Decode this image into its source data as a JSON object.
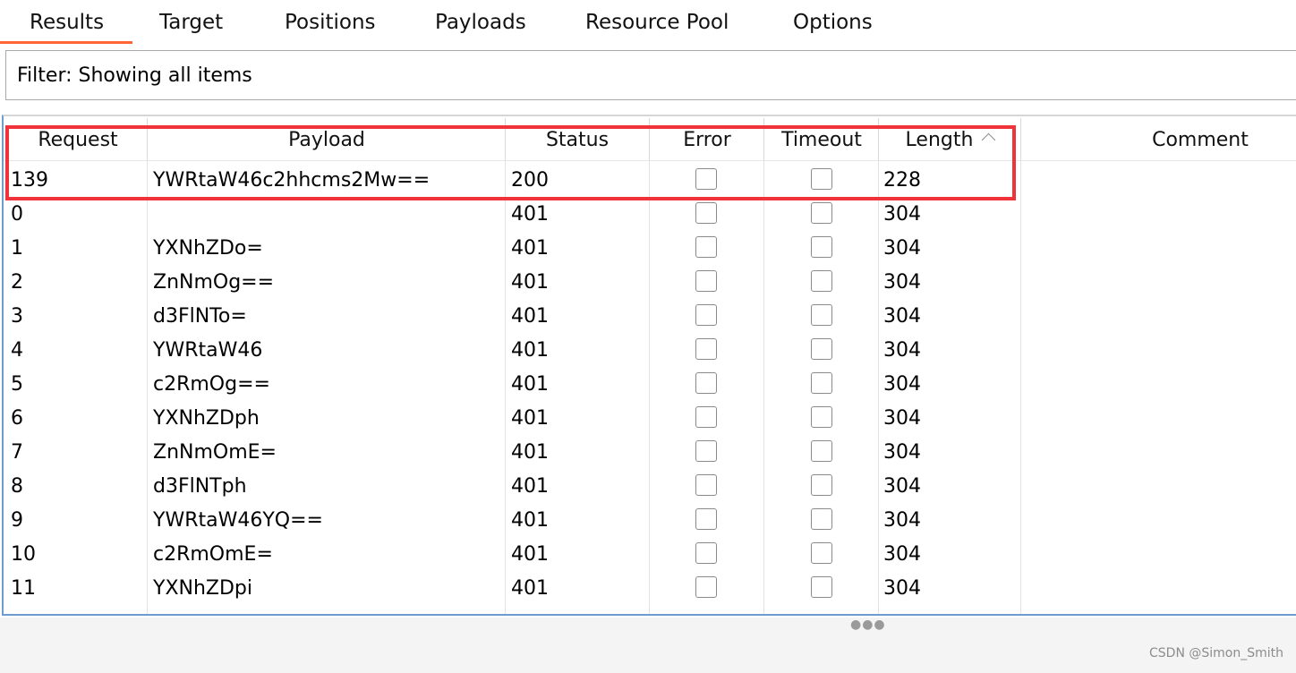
{
  "tabs": [
    {
      "label": "Results",
      "active": true
    },
    {
      "label": "Target",
      "active": false
    },
    {
      "label": "Positions",
      "active": false
    },
    {
      "label": "Payloads",
      "active": false
    },
    {
      "label": "Resource Pool",
      "active": false
    },
    {
      "label": "Options",
      "active": false
    }
  ],
  "accent_color": "#ff6633",
  "highlight_color": "#f0323a",
  "filter": {
    "text": "Filter: Showing all items"
  },
  "table": {
    "columns": {
      "request": "Request",
      "payload": "Payload",
      "status": "Status",
      "error": "Error",
      "timeout": "Timeout",
      "length": "Length",
      "comment": "Comment"
    },
    "sort": {
      "column": "Length",
      "direction": "ascending",
      "icon": "chevron-up-icon"
    },
    "rows": [
      {
        "request": "139",
        "payload": "YWRtaW46c2hhcms2Mw==",
        "status": "200",
        "error": false,
        "timeout": false,
        "length": "228",
        "comment": ""
      },
      {
        "request": "0",
        "payload": "",
        "status": "401",
        "error": false,
        "timeout": false,
        "length": "304",
        "comment": ""
      },
      {
        "request": "1",
        "payload": "YXNhZDo=",
        "status": "401",
        "error": false,
        "timeout": false,
        "length": "304",
        "comment": ""
      },
      {
        "request": "2",
        "payload": "ZnNmOg==",
        "status": "401",
        "error": false,
        "timeout": false,
        "length": "304",
        "comment": ""
      },
      {
        "request": "3",
        "payload": "d3FlNTo=",
        "status": "401",
        "error": false,
        "timeout": false,
        "length": "304",
        "comment": ""
      },
      {
        "request": "4",
        "payload": "YWRtaW46",
        "status": "401",
        "error": false,
        "timeout": false,
        "length": "304",
        "comment": ""
      },
      {
        "request": "5",
        "payload": "c2RmOg==",
        "status": "401",
        "error": false,
        "timeout": false,
        "length": "304",
        "comment": ""
      },
      {
        "request": "6",
        "payload": "YXNhZDph",
        "status": "401",
        "error": false,
        "timeout": false,
        "length": "304",
        "comment": ""
      },
      {
        "request": "7",
        "payload": "ZnNmOmE=",
        "status": "401",
        "error": false,
        "timeout": false,
        "length": "304",
        "comment": ""
      },
      {
        "request": "8",
        "payload": "d3FlNTph",
        "status": "401",
        "error": false,
        "timeout": false,
        "length": "304",
        "comment": ""
      },
      {
        "request": "9",
        "payload": "YWRtaW46YQ==",
        "status": "401",
        "error": false,
        "timeout": false,
        "length": "304",
        "comment": ""
      },
      {
        "request": "10",
        "payload": "c2RmOmE=",
        "status": "401",
        "error": false,
        "timeout": false,
        "length": "304",
        "comment": ""
      },
      {
        "request": "11",
        "payload": "YXNhZDpi",
        "status": "401",
        "error": false,
        "timeout": false,
        "length": "304",
        "comment": ""
      }
    ]
  },
  "watermark": "CSDN @Simon_Smith"
}
